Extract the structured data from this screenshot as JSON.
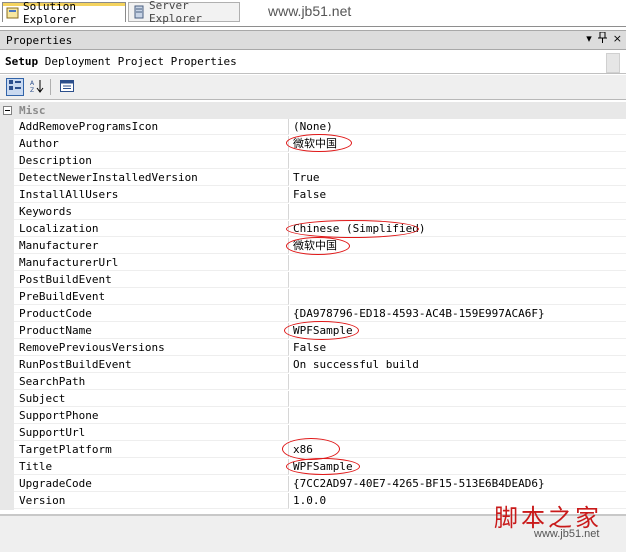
{
  "tabs": {
    "solution_explorer": "Solution Explorer",
    "server_explorer": "Server Explorer"
  },
  "watermark": "www.jb51.net",
  "panel": {
    "title": "Properties",
    "dropdown_glyph": "▾",
    "pin_glyph": "ᵖ",
    "close_glyph": "×"
  },
  "object_selector": {
    "bold": "Setup",
    "rest": " Deployment Project Properties"
  },
  "category": {
    "label": "Misc"
  },
  "properties": [
    {
      "name": "AddRemoveProgramsIcon",
      "value": "(None)"
    },
    {
      "name": "Author",
      "value": "微软中国"
    },
    {
      "name": "Description",
      "value": ""
    },
    {
      "name": "DetectNewerInstalledVersion",
      "value": "True"
    },
    {
      "name": "InstallAllUsers",
      "value": "False"
    },
    {
      "name": "Keywords",
      "value": ""
    },
    {
      "name": "Localization",
      "value": "Chinese (Simplified)"
    },
    {
      "name": "Manufacturer",
      "value": "微软中国"
    },
    {
      "name": "ManufacturerUrl",
      "value": ""
    },
    {
      "name": "PostBuildEvent",
      "value": ""
    },
    {
      "name": "PreBuildEvent",
      "value": ""
    },
    {
      "name": "ProductCode",
      "value": "{DA978796-ED18-4593-AC4B-159E997ACA6F}"
    },
    {
      "name": "ProductName",
      "value": "WPFSample"
    },
    {
      "name": "RemovePreviousVersions",
      "value": "False"
    },
    {
      "name": "RunPostBuildEvent",
      "value": "On successful build"
    },
    {
      "name": "SearchPath",
      "value": ""
    },
    {
      "name": "Subject",
      "value": ""
    },
    {
      "name": "SupportPhone",
      "value": ""
    },
    {
      "name": "SupportUrl",
      "value": ""
    },
    {
      "name": "TargetPlatform",
      "value": "x86"
    },
    {
      "name": "Title",
      "value": "WPFSample"
    },
    {
      "name": "UpgradeCode",
      "value": "{7CC2AD97-40E7-4265-BF15-513E6B4DEAD6}"
    },
    {
      "name": "Version",
      "value": "1.0.0"
    }
  ],
  "logo": {
    "chinese": "脚本之家",
    "url": "www.jb51.net"
  }
}
